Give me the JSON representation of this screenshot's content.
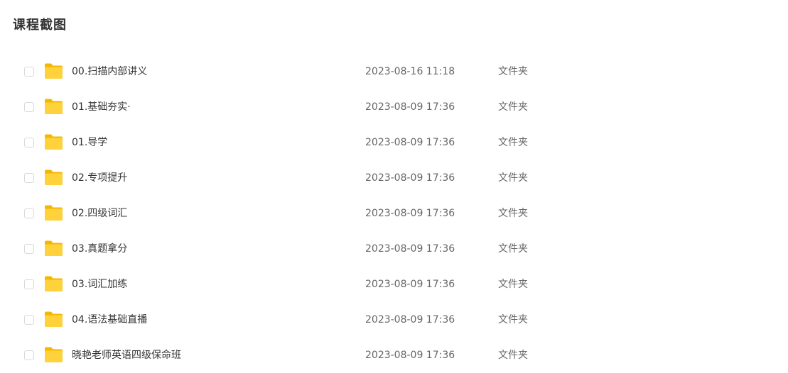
{
  "page": {
    "title": "课程截图"
  },
  "theme": {
    "folder_color_back": "#F5B800",
    "folder_color_front": "#FFD13A"
  },
  "files": [
    {
      "name": "00.扫描内部讲义",
      "date": "2023-08-16 11:18",
      "type": "文件夹",
      "icon": "folder-icon"
    },
    {
      "name": "01.基础夯实·",
      "date": "2023-08-09 17:36",
      "type": "文件夹",
      "icon": "folder-icon"
    },
    {
      "name": "01.导学",
      "date": "2023-08-09 17:36",
      "type": "文件夹",
      "icon": "folder-icon"
    },
    {
      "name": "02.专项提升",
      "date": "2023-08-09 17:36",
      "type": "文件夹",
      "icon": "folder-icon"
    },
    {
      "name": "02.四级词汇",
      "date": "2023-08-09 17:36",
      "type": "文件夹",
      "icon": "folder-icon"
    },
    {
      "name": "03.真题拿分",
      "date": "2023-08-09 17:36",
      "type": "文件夹",
      "icon": "folder-icon"
    },
    {
      "name": "03.词汇加练",
      "date": "2023-08-09 17:36",
      "type": "文件夹",
      "icon": "folder-icon"
    },
    {
      "name": "04.语法基础直播",
      "date": "2023-08-09 17:36",
      "type": "文件夹",
      "icon": "folder-icon"
    },
    {
      "name": "晓艳老师英语四级保命班",
      "date": "2023-08-09 17:36",
      "type": "文件夹",
      "icon": "folder-icon"
    }
  ]
}
